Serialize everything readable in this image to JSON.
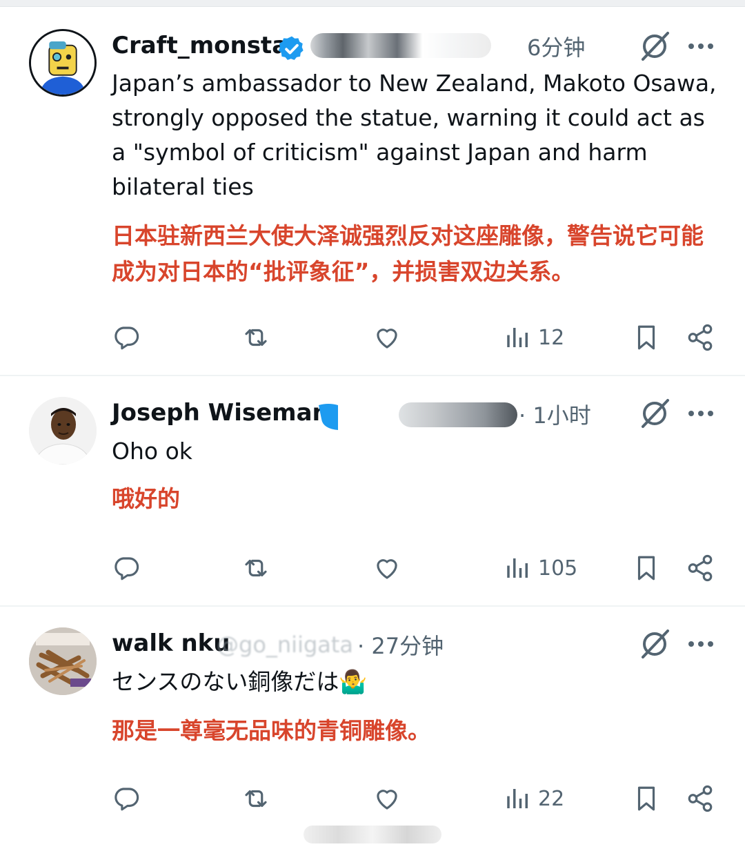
{
  "colors": {
    "text": "#0f1419",
    "secondary": "#536471",
    "translation": "#d8452c",
    "verified": "#1d9bf0",
    "divider": "#eff3f4"
  },
  "posts": [
    {
      "author": "Craft_monsta",
      "verified": true,
      "time": "6分钟",
      "text": "Japan’s ambassador to New Zealand, Makoto Osawa, strongly opposed the statue, warning it could act as a \"symbol of criticism\" against Japan and harm bilateral ties",
      "translation": "日本驻新西兰大使大泽诚强烈反对这座雕像，警告说它可能成为对日本的“批评象征”，并损害双边关系。",
      "views": "12"
    },
    {
      "author": "Joseph Wiseman",
      "verified": true,
      "time": "· 1小时",
      "text": "Oho ok",
      "translation": "哦好的",
      "views": "105"
    },
    {
      "author": "walk nku",
      "handle_fragment": "@go_niigata",
      "time": "· 27分钟",
      "text": "センスのない銅像だは🤷‍♂️",
      "translation": "那是一尊毫无品味的青铜雕像。",
      "views": "22"
    }
  ],
  "icons": {
    "reply": "reply-icon",
    "repost": "repost-icon",
    "like": "like-icon",
    "views": "views-icon",
    "bookmark": "bookmark-icon",
    "share": "share-icon",
    "grok": "grok-icon",
    "more": "more-icon",
    "verified": "verified-badge-icon"
  }
}
